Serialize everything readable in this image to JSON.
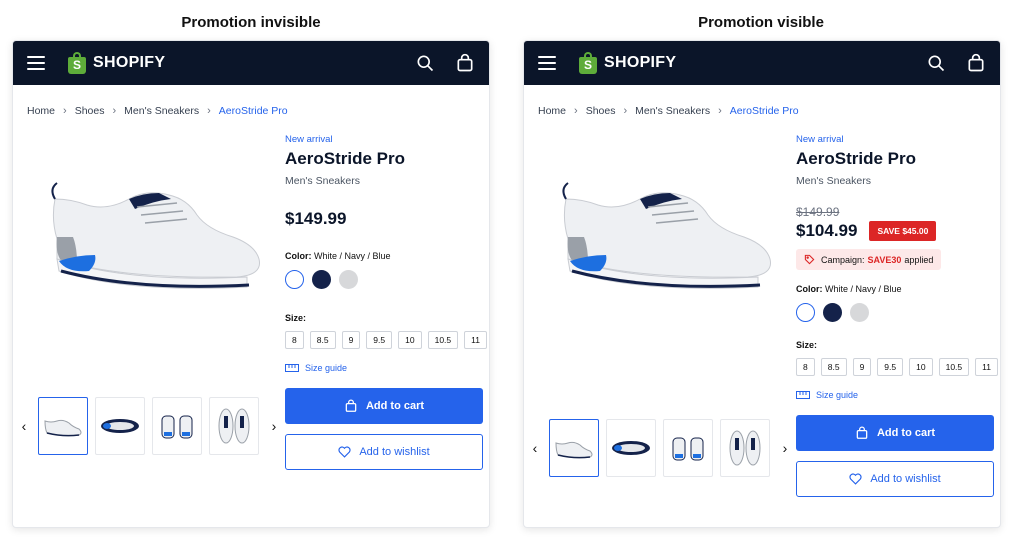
{
  "captions": {
    "left": "Promotion invisible",
    "right": "Promotion visible"
  },
  "brand": {
    "name": "SHOPIFY",
    "logo_letter": "S"
  },
  "breadcrumb": [
    "Home",
    "Shoes",
    "Men's Sneakers",
    "AeroStride Pro"
  ],
  "product": {
    "badge": "New arrival",
    "title": "AeroStride Pro",
    "category": "Men's Sneakers",
    "color_label": "Color:",
    "color_value": "White / Navy / Blue",
    "size_label": "Size:",
    "sizes": [
      "8",
      "8.5",
      "9",
      "9.5",
      "10",
      "10.5",
      "11"
    ],
    "size_guide": "Size guide",
    "add_to_cart": "Add to cart",
    "add_to_wishlist": "Add to wishlist"
  },
  "pricing": {
    "regular_price": "$149.99",
    "sale_price": "$104.99",
    "save_badge": "SAVE $45.00",
    "campaign_prefix": "Campaign:",
    "campaign_code": "SAVE30",
    "campaign_suffix": "applied"
  },
  "colors": {
    "navbar": "#0b1529",
    "accent": "#2563eb",
    "sale": "#dc2626",
    "brand_green": "#5eac3a"
  },
  "icons": [
    "menu-icon",
    "search-icon",
    "shopping-bag-icon",
    "chevron-right-icon",
    "chevron-left-icon",
    "ruler-icon",
    "heart-icon",
    "tag-icon"
  ]
}
